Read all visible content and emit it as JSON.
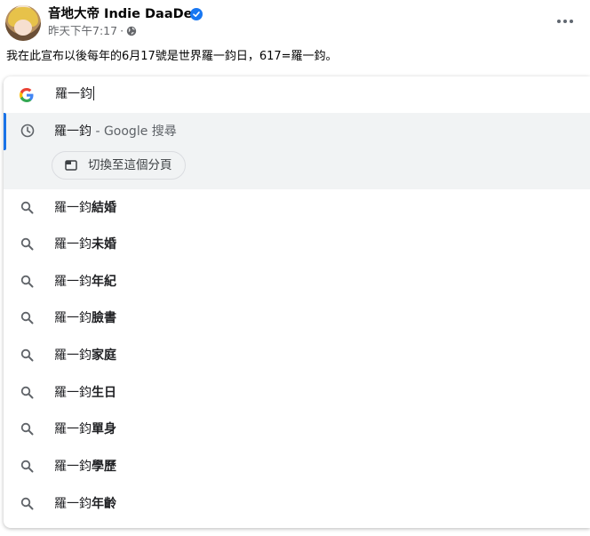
{
  "post": {
    "author": "音地大帝 Indie DaaDee",
    "time": "昨天下午7:17",
    "separator": "·",
    "text": "我在此宣布以後每年的6月17號是世界羅一鈞日，617=羅一鈞。"
  },
  "omnibox": {
    "typed": "羅一鈞",
    "selected": {
      "query": "羅一鈞",
      "suffix": " - Google 搜尋",
      "switch_tab_label": "切換至這個分頁"
    },
    "suggestions": [
      {
        "base": "羅一鈞",
        "completion": "結婚"
      },
      {
        "base": "羅一鈞",
        "completion": "未婚"
      },
      {
        "base": "羅一鈞",
        "completion": "年紀"
      },
      {
        "base": "羅一鈞",
        "completion": "臉書"
      },
      {
        "base": "羅一鈞",
        "completion": "家庭"
      },
      {
        "base": "羅一鈞",
        "completion": "生日"
      },
      {
        "base": "羅一鈞",
        "completion": "單身"
      },
      {
        "base": "羅一鈞",
        "completion": "學歷"
      },
      {
        "base": "羅一鈞",
        "completion": "年齡"
      }
    ]
  },
  "icons": {
    "avatar": "profile-photo",
    "verified": "verified-badge-icon",
    "audience": "globe-icon",
    "more": "more-options-icon",
    "omnibox": "google-g-icon",
    "history": "history-clock-icon",
    "tab": "tab-icon",
    "suggestion": "search-icon"
  },
  "colors": {
    "accent": "#1a73e8",
    "verified": "#1877f2",
    "selected_bg": "#f1f3f4",
    "meta_text": "#65676b"
  }
}
